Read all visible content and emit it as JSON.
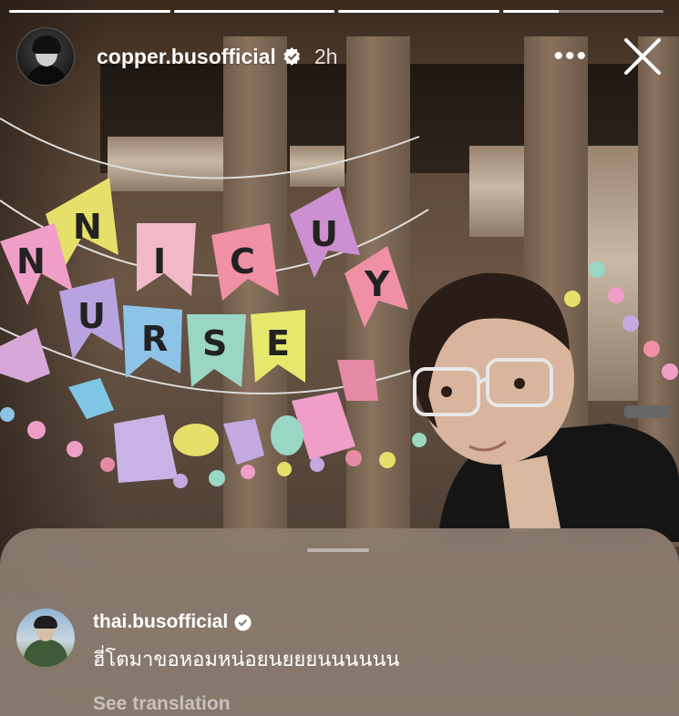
{
  "story": {
    "progress": [
      1,
      1,
      1,
      0.35
    ],
    "username": "copper.busofficial",
    "time": "2h",
    "more_label": "•••",
    "icons": {
      "avatar": "profile-avatar",
      "verified": "verified-badge-icon",
      "more": "more-options-icon",
      "close": "close-icon"
    }
  },
  "photo": {
    "banner_top_letters": [
      "N",
      "I",
      "C",
      "U"
    ],
    "banner_bottom_letters": [
      "N",
      "U",
      "R",
      "S",
      "E",
      "Y"
    ]
  },
  "sheet": {
    "comment": {
      "username": "thai.busofficial",
      "text": "ฮี่โตมาขอหอมหน่อยนยยยนนนนนน",
      "translate_label": "See translation"
    }
  },
  "colors": {
    "verified": "#ffffff",
    "text": "#ffffff"
  }
}
